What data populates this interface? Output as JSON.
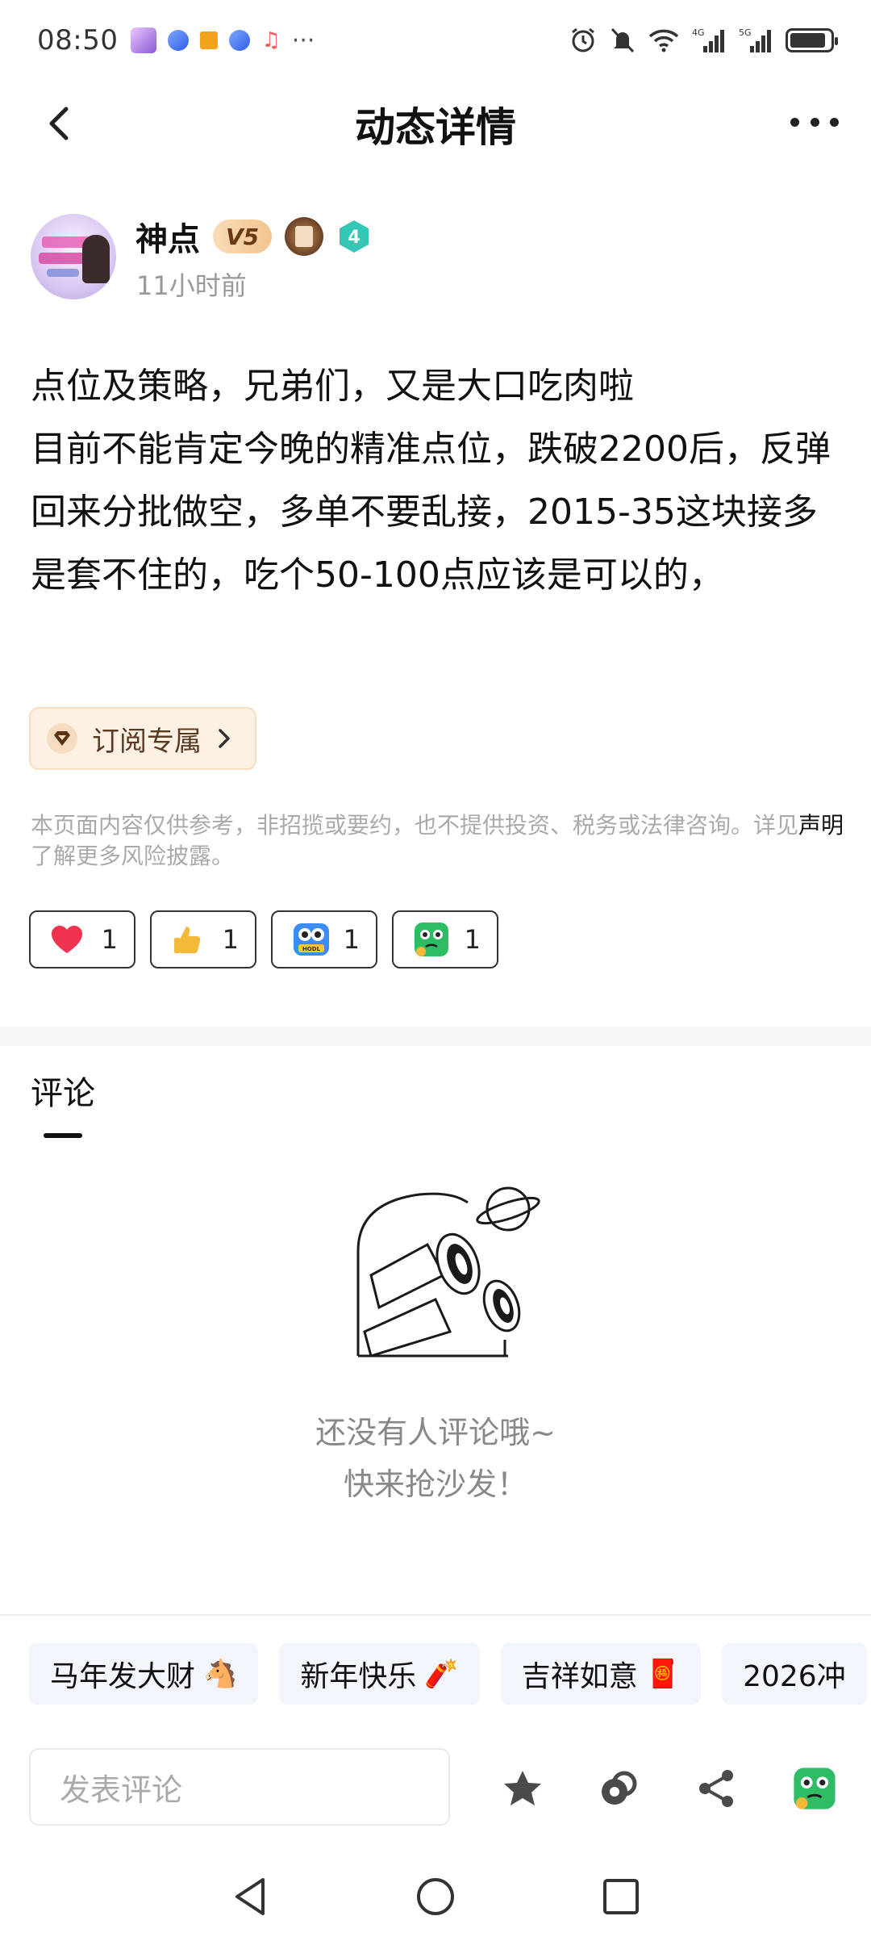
{
  "status_bar": {
    "time": "08:50",
    "left_icons": [
      "avatar-app-icon",
      "browser-icon",
      "office-icon",
      "browser-icon",
      "music-icon"
    ],
    "overflow": "···",
    "network_1": "4G",
    "network_2": "5G",
    "battery_level": 0.9
  },
  "nav": {
    "title": "动态详情"
  },
  "author": {
    "name": "神点",
    "vip_badge": "V5",
    "level_badge": "4",
    "time": "11小时前"
  },
  "post": {
    "lines": [
      "点位及策略，兄弟们，又是大口吃肉啦",
      "目前不能肯定今晚的精准点位，跌破2200后，反弹回来分批做空，多单不要乱接，2015-35这块接多是套不住的，吃个50-100点应该是可以的，"
    ]
  },
  "subscribe": {
    "label": "订阅专属"
  },
  "disclaimer": {
    "text_before": "本页面内容仅供参考，非招揽或要约，也不提供投资、税务或法律咨询。详见",
    "link": "声明",
    "text_after": "了解更多风险披露。"
  },
  "reactions": [
    {
      "icon": "heart-icon",
      "count": "1"
    },
    {
      "icon": "thumbs-up-icon",
      "count": "1"
    },
    {
      "icon": "hodl-owl-icon",
      "count": "1"
    },
    {
      "icon": "thinking-face-icon",
      "count": "1"
    }
  ],
  "comments": {
    "tab_label": "评论",
    "empty_line1": "还没有人评论哦~",
    "empty_line2": "快来抢沙发！"
  },
  "quick_replies": [
    {
      "text": "马年发大财",
      "emoji": "🐴"
    },
    {
      "text": "新年快乐",
      "emoji": "🧨"
    },
    {
      "text": "吉祥如意",
      "emoji": "🧧"
    },
    {
      "text": "2026冲",
      "emoji": ""
    }
  ],
  "composer": {
    "placeholder": "发表评论"
  },
  "colors": {
    "accent_teal": "#34c7b5",
    "heart": "#f0334f",
    "subscribe_bg": "#fdf1e3",
    "chip_bg": "#f2f5fb"
  }
}
